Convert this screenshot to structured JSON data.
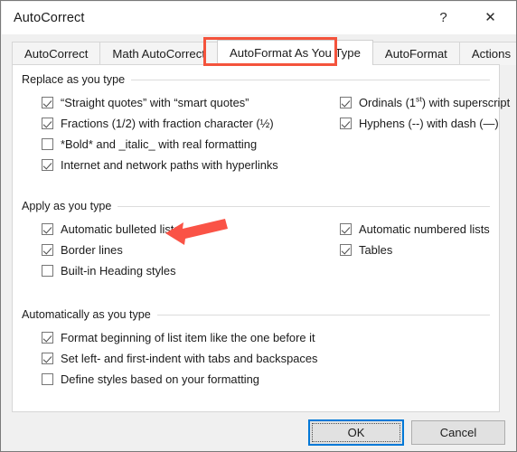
{
  "window": {
    "title": "AutoCorrect",
    "help_glyph": "?",
    "close_glyph": "✕"
  },
  "tabs": [
    {
      "label": "AutoCorrect",
      "active": false
    },
    {
      "label": "Math AutoCorrect",
      "active": false
    },
    {
      "label": "AutoFormat As You Type",
      "active": true
    },
    {
      "label": "AutoFormat",
      "active": false
    },
    {
      "label": "Actions",
      "active": false
    }
  ],
  "groups": {
    "replace": {
      "label": "Replace as you type",
      "left_items": [
        {
          "label": "“Straight quotes” with “smart quotes”",
          "checked": true
        },
        {
          "label": "Fractions (1/2) with fraction character (½)",
          "checked": true
        },
        {
          "label": "*Bold* and _italic_ with real formatting",
          "checked": false
        },
        {
          "label": "Internet and network paths with hyperlinks",
          "checked": true
        }
      ],
      "right_items": [
        {
          "label": "Ordinals (1",
          "superscript": "st",
          "label_tail": ") with superscript",
          "checked": true
        },
        {
          "label": "Hyphens (--) with dash (—)",
          "checked": true
        }
      ]
    },
    "apply": {
      "label": "Apply as you type",
      "left_items": [
        {
          "label": "Automatic bulleted lists",
          "checked": true
        },
        {
          "label": "Border lines",
          "checked": true
        },
        {
          "label": "Built-in Heading styles",
          "checked": false
        }
      ],
      "right_items": [
        {
          "label": "Automatic numbered lists",
          "checked": true
        },
        {
          "label": "Tables",
          "checked": true
        }
      ]
    },
    "automatically": {
      "label": "Automatically as you type",
      "left_items": [
        {
          "label": "Format beginning of list item like the one before it",
          "checked": true
        },
        {
          "label": "Set left- and first-indent with tabs and backspaces",
          "checked": true
        },
        {
          "label": "Define styles based on your formatting",
          "checked": false
        }
      ],
      "right_items": []
    }
  },
  "footer": {
    "ok_label": "OK",
    "cancel_label": "Cancel"
  },
  "annotations": {
    "arrow_color": "#fa5346",
    "tab_highlight_color": "#f4533c"
  }
}
